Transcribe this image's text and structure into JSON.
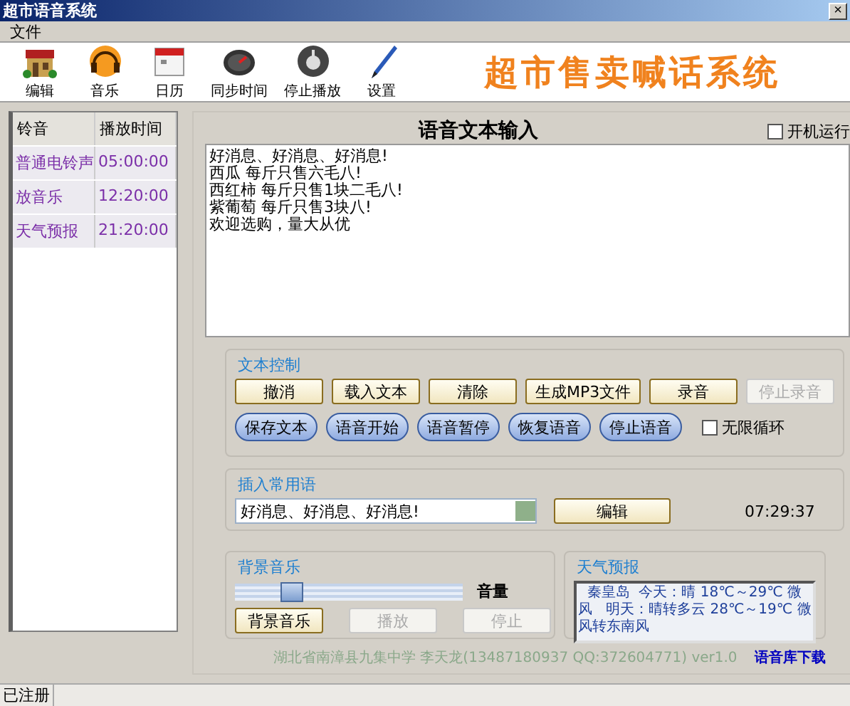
{
  "window": {
    "title": "超市语音系统",
    "close": "×"
  },
  "menu": [
    "文件"
  ],
  "toolbar": [
    {
      "label": "编辑",
      "kind": "house"
    },
    {
      "label": "音乐",
      "kind": "headphones"
    },
    {
      "label": "日历",
      "kind": "calendar"
    },
    {
      "label": "同步时间",
      "kind": "gauge"
    },
    {
      "label": "停止播放",
      "kind": "stop"
    },
    {
      "label": "设置",
      "kind": "pen"
    }
  ],
  "banner": "超市售卖喊话系统",
  "schedule": {
    "columns": [
      "铃音",
      "播放时间"
    ],
    "rows": [
      {
        "name": "普通电铃声",
        "time": "05:00:00"
      },
      {
        "name": "放音乐",
        "time": "12:20:00"
      },
      {
        "name": "天气预报",
        "time": "21:20:00"
      }
    ]
  },
  "editor": {
    "title": "语音文本输入",
    "autostart": {
      "label": "开机运行",
      "checked": false
    },
    "lines": [
      "好消息、好消息、好消息!",
      "西瓜 每斤只售六毛八!",
      "西红柿 每斤只售1块二毛八!",
      "紫葡萄 每斤只售3块八!",
      "欢迎选购，量大从优"
    ]
  },
  "text_control": {
    "title": "文本控制",
    "buttons": [
      {
        "label": "撤消",
        "kind": "rect",
        "disabled": false
      },
      {
        "label": "载入文本",
        "kind": "rect",
        "disabled": false
      },
      {
        "label": "清除",
        "kind": "rect",
        "disabled": false
      },
      {
        "label": "生成MP3文件",
        "kind": "rect",
        "disabled": false
      },
      {
        "label": "录音",
        "kind": "rect",
        "disabled": false
      },
      {
        "label": "停止录音",
        "kind": "rect",
        "disabled": true
      },
      {
        "label": "保存文本",
        "kind": "pill",
        "disabled": false
      },
      {
        "label": "语音开始",
        "kind": "pill",
        "disabled": false
      },
      {
        "label": "语音暂停",
        "kind": "pill",
        "disabled": false
      },
      {
        "label": "恢复语音",
        "kind": "pill",
        "disabled": false
      },
      {
        "label": "停止语音",
        "kind": "pill",
        "disabled": false
      }
    ],
    "loop": {
      "label": "无限循环",
      "checked": false
    }
  },
  "phrases": {
    "title": "插入常用语",
    "value": "好消息、好消息、好消息!",
    "button": "编辑",
    "clock": "07:29:37"
  },
  "background_music": {
    "title": "背景音乐",
    "level": 0.25,
    "volume_label": "音量",
    "buttons": [
      {
        "label": "背景音乐",
        "disabled": false
      },
      {
        "label": "播放",
        "disabled": true
      },
      {
        "label": "停止",
        "disabled": true
      }
    ]
  },
  "weather": {
    "title": "天气预报",
    "text": "  秦皇岛  今天：晴 18℃～29℃ 微风   明天：晴转多云 28℃～19℃ 微风转东南风"
  },
  "footer": {
    "credit": "湖北省南漳县九集中学  李天龙(13487180937 QQ:372604771)  ver1.0",
    "link": "语音库下载"
  },
  "status_bar": "已注册"
}
